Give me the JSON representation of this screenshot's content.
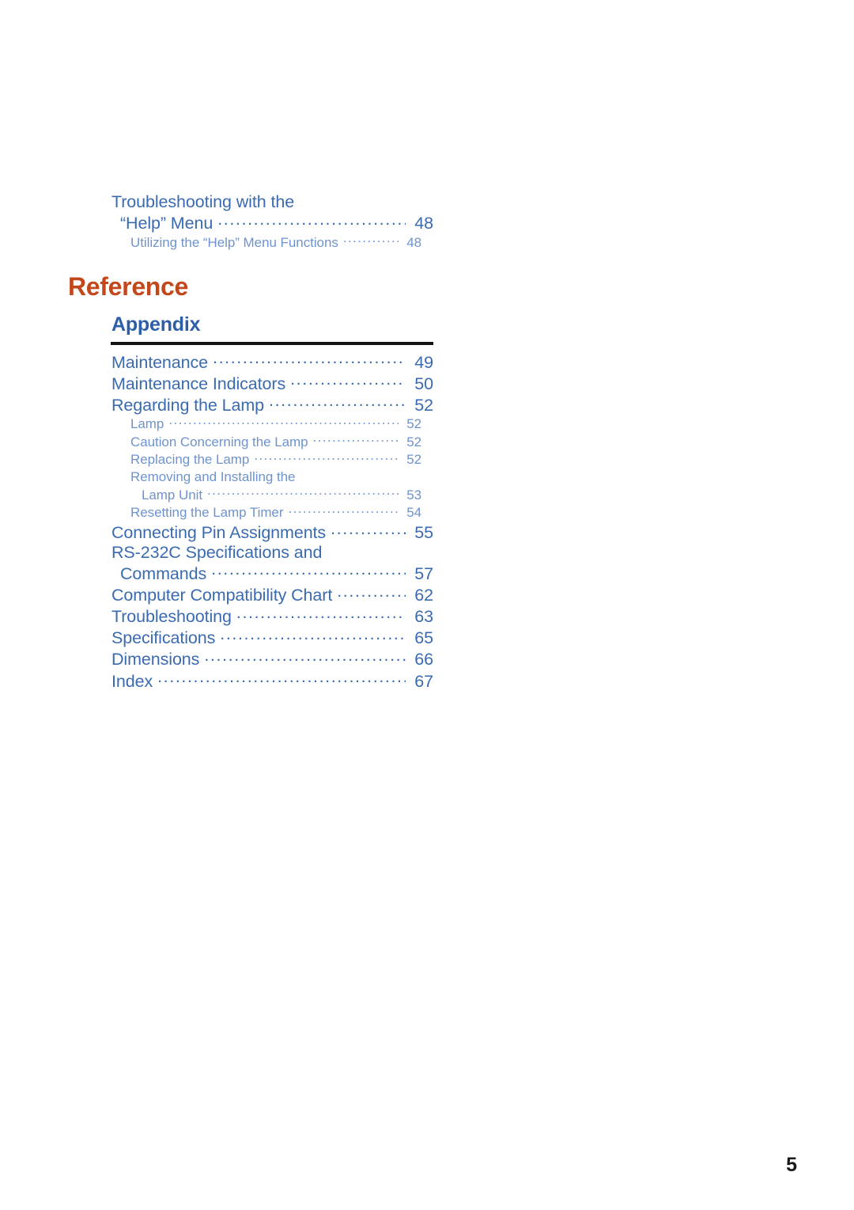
{
  "page": {
    "folio": "5",
    "background_color": "#ffffff"
  },
  "colors": {
    "chapter_title": "#C2481C",
    "section_title": "#2D5FA8",
    "level1_entry": "#3A6BB0",
    "level2_entry": "#6E93CE",
    "rule": "#141414",
    "folio": "#1A1A1A"
  },
  "toc_top": {
    "entries": [
      {
        "level": 1,
        "line1": "Troubleshooting with the",
        "line2": "“Help” Menu",
        "page": "48"
      },
      {
        "level": 2,
        "label": "Utilizing the “Help” Menu Functions",
        "page": "48"
      }
    ]
  },
  "chapter": {
    "title": "Reference"
  },
  "section": {
    "title": "Appendix"
  },
  "appendix": {
    "entries": [
      {
        "level": 1,
        "label": "Maintenance",
        "page": "49"
      },
      {
        "level": 1,
        "label": "Maintenance Indicators",
        "page": "50"
      },
      {
        "level": 1,
        "label": "Regarding the Lamp",
        "page": "52"
      },
      {
        "level": 2,
        "label": "Lamp",
        "page": "52"
      },
      {
        "level": 2,
        "label": "Caution Concerning the Lamp",
        "page": "52"
      },
      {
        "level": 2,
        "label": "Replacing the Lamp",
        "page": "52"
      },
      {
        "level": 2,
        "line1": "Removing and Installing the",
        "line2": "Lamp Unit",
        "page": "53"
      },
      {
        "level": 2,
        "label": "Resetting the Lamp Timer",
        "page": "54"
      },
      {
        "level": 1,
        "label": "Connecting Pin Assignments",
        "page": "55"
      },
      {
        "level": 1,
        "line1": "RS-232C Specifications and",
        "line2": "Commands",
        "page": "57"
      },
      {
        "level": 1,
        "label": "Computer Compatibility Chart",
        "page": "62"
      },
      {
        "level": 1,
        "label": "Troubleshooting",
        "page": "63"
      },
      {
        "level": 1,
        "label": "Specifications",
        "page": "65"
      },
      {
        "level": 1,
        "label": "Dimensions",
        "page": "66"
      },
      {
        "level": 1,
        "label": "Index",
        "page": "67"
      }
    ]
  }
}
